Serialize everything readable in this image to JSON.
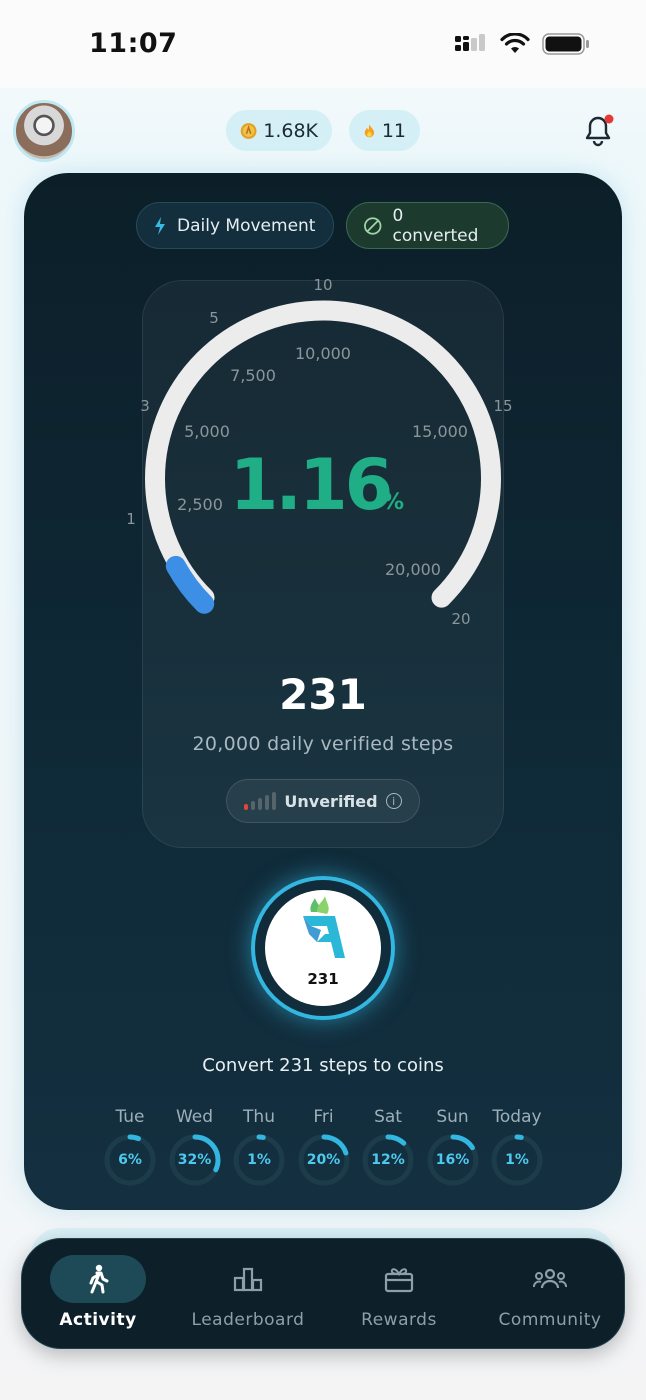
{
  "status_bar": {
    "time": "11:07"
  },
  "header": {
    "coins": "1.68K",
    "streak": "11"
  },
  "card": {
    "chip_daily": "Daily Movement",
    "chip_converted": "0 converted",
    "gauge": {
      "percent_value": "1.16",
      "percent_unit": "%",
      "progress_fraction": 0.0116,
      "outer_labels": [
        "1",
        "3",
        "5",
        "10",
        "15",
        "20"
      ],
      "inner_labels": [
        "2,500",
        "5,000",
        "7,500",
        "10,000",
        "15,000",
        "20,000"
      ]
    },
    "steps": "231",
    "steps_subtitle": "20,000 daily verified steps",
    "verify_status": "Unverified",
    "convert_badge_steps": "231",
    "convert_label": "Convert 231 steps to coins",
    "week": [
      {
        "day": "Tue",
        "pct": "6%",
        "fraction": 0.06
      },
      {
        "day": "Wed",
        "pct": "32%",
        "fraction": 0.32
      },
      {
        "day": "Thu",
        "pct": "1%",
        "fraction": 0.01
      },
      {
        "day": "Fri",
        "pct": "20%",
        "fraction": 0.2
      },
      {
        "day": "Sat",
        "pct": "12%",
        "fraction": 0.12
      },
      {
        "day": "Sun",
        "pct": "16%",
        "fraction": 0.16
      },
      {
        "day": "Today",
        "pct": "1%",
        "fraction": 0.01
      }
    ]
  },
  "tabs": [
    {
      "label": "Activity",
      "icon": "walking-person-icon",
      "active": true
    },
    {
      "label": "Leaderboard",
      "icon": "leaderboard-icon",
      "active": false
    },
    {
      "label": "Rewards",
      "icon": "gift-icon",
      "active": false
    },
    {
      "label": "Community",
      "icon": "community-icon",
      "active": false
    }
  ],
  "colors": {
    "accent": "#33b6e0",
    "gauge_text": "#1fae86",
    "notification_dot": "#e53935"
  }
}
